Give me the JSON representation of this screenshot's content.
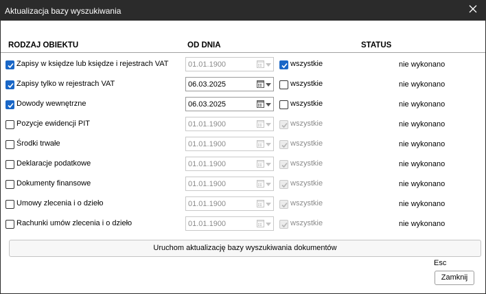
{
  "window": {
    "title": "Aktualizacja bazy wyszukiwania",
    "close_icon": "close-icon"
  },
  "header": {
    "col_object": "RODZAJ OBIEKTU",
    "col_date": "OD DNIA",
    "col_status": "STATUS"
  },
  "rows": [
    {
      "label": "Zapisy w księdze lub księdze i rejestrach VAT",
      "checked": true,
      "date": "01.01.1900",
      "date_enabled": false,
      "all_label": "wszystkie",
      "all_checked": true,
      "all_enabled": true,
      "status": "nie wykonano"
    },
    {
      "label": "Zapisy tylko w rejestrach VAT",
      "checked": true,
      "date": "06.03.2025",
      "date_enabled": true,
      "all_label": "wszystkie",
      "all_checked": false,
      "all_enabled": true,
      "status": "nie wykonano"
    },
    {
      "label": "Dowody wewnętrzne",
      "checked": true,
      "date": "06.03.2025",
      "date_enabled": true,
      "all_label": "wszystkie",
      "all_checked": false,
      "all_enabled": true,
      "status": "nie wykonano"
    },
    {
      "label": "Pozycje ewidencji PIT",
      "checked": false,
      "date": "01.01.1900",
      "date_enabled": false,
      "all_label": "wszystkie",
      "all_checked": true,
      "all_enabled": false,
      "status": "nie wykonano"
    },
    {
      "label": "Środki trwałe",
      "checked": false,
      "date": "01.01.1900",
      "date_enabled": false,
      "all_label": "wszystkie",
      "all_checked": true,
      "all_enabled": false,
      "status": "nie wykonano"
    },
    {
      "label": "Deklaracje podatkowe",
      "checked": false,
      "date": "01.01.1900",
      "date_enabled": false,
      "all_label": "wszystkie",
      "all_checked": true,
      "all_enabled": false,
      "status": "nie wykonano"
    },
    {
      "label": "Dokumenty finansowe",
      "checked": false,
      "date": "01.01.1900",
      "date_enabled": false,
      "all_label": "wszystkie",
      "all_checked": true,
      "all_enabled": false,
      "status": "nie wykonano"
    },
    {
      "label": "Umowy zlecenia i o dzieło",
      "checked": false,
      "date": "01.01.1900",
      "date_enabled": false,
      "all_label": "wszystkie",
      "all_checked": true,
      "all_enabled": false,
      "status": "nie wykonano"
    },
    {
      "label": "Rachunki umów zlecenia i o dzieło",
      "checked": false,
      "date": "01.01.1900",
      "date_enabled": false,
      "all_label": "wszystkie",
      "all_checked": true,
      "all_enabled": false,
      "status": "nie wykonano"
    }
  ],
  "actions": {
    "run_label": "Uruchom aktualizację bazy wyszukiwania dokumentów",
    "esc_hint": "Esc",
    "close_label": "Zamknij"
  },
  "colors": {
    "accent": "#1a67c7",
    "titlebar": "#2b2b2b"
  }
}
